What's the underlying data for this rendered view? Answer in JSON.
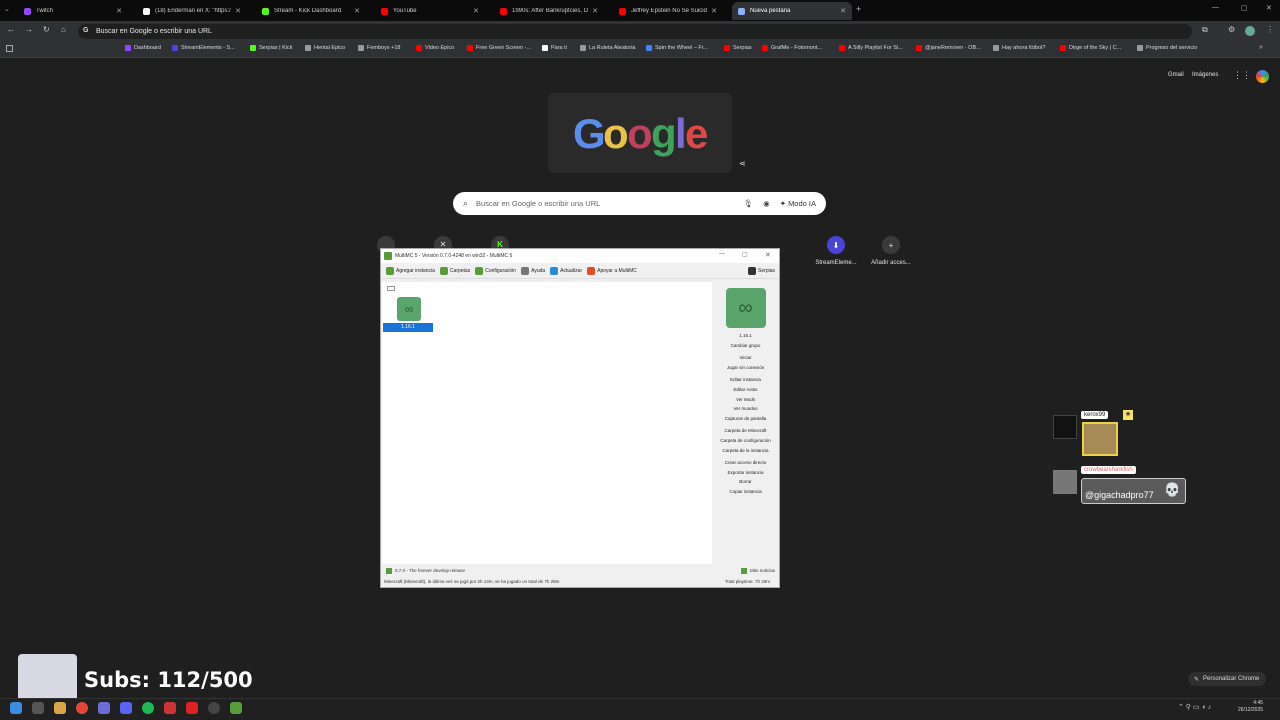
{
  "browser": {
    "tabs": [
      {
        "title": "Twitch",
        "color": "#9146ff"
      },
      {
        "title": "(18) Enderman en X: \"https://t...",
        "color": "#ffffff"
      },
      {
        "title": "Stream - Kick Dashboard",
        "color": "#53fc18"
      },
      {
        "title": "YouTube",
        "color": "#ff0000"
      },
      {
        "title": "1990s: After Bankruptcies, Don...",
        "color": "#ff0000"
      },
      {
        "title": "Jeffrey Epstein No Se Suicidó |...",
        "color": "#ff0000"
      },
      {
        "title": "Nueva pestaña",
        "color": "#8ab4f8"
      }
    ],
    "omnibox": "Buscar en Google o escribir una URL",
    "bookmarks": [
      "Dashboard",
      "StreamElements - S...",
      "Serpias | Kick",
      "Hentai Epico",
      "Femboys +18",
      "Video Epico",
      "Free Green Screen -...",
      "Para ti",
      "La Ruleta Aleatoria",
      "Spin the Wheel – Fr...",
      "Serpias",
      "GrafMe - Fotomont...",
      "A Silly Playlist For Si...",
      "@janeRemover - OB...",
      "Hay ahora fútbol?",
      "Dirge of the Sky | C...",
      "Progreso del servicio"
    ]
  },
  "google": {
    "header_links": [
      "Gmail",
      "Imágenes"
    ],
    "search_placeholder": "Buscar en Google o escribir una URL",
    "ai_mode": "Modo IA",
    "shortcuts": [
      "StreamEleme...",
      "Añadir acces..."
    ],
    "customize": "Personalizar Chrome"
  },
  "multimc": {
    "title": "MultiMC 5 - Versión 0.7.0-4248 en win32 - MultiMC 5",
    "toolbar": [
      "Agregar instancia",
      "Carpetas",
      "Configuración",
      "Ayuda",
      "Actualizar",
      "Apoyar a MultiMC",
      "Serpias"
    ],
    "instance_label": "1.16.1",
    "side_version": "1.16.1",
    "side_group": "Cambiar grupo",
    "side_actions": [
      "Iniciar",
      "Jugar sin conexión",
      "Editar instancia",
      "Editar notas",
      "Ver Mods",
      "Ver mundos",
      "Capturas de pantalla",
      "Carpeta de Minecraft",
      "Carpeta de configuración",
      "Carpeta de la instancia",
      "Crear acceso directo",
      "Exportar instancia",
      "Borrar",
      "Copiar instancia"
    ],
    "news": "0.7.0 - The forever develop release",
    "more_news": "Más noticias",
    "status": "Minecraft (Minecraft), la última vez se jugó por 2h 13m, se ha jugado un total de 7h 29m",
    "total_playtime": "Total playtime: 7h 29m"
  },
  "overlay": {
    "chat_names": [
      "kerox99",
      "crowbearsharkfish",
      "@gigachadpro77"
    ],
    "subs": "Subs: 112/500"
  },
  "taskbar": {
    "time": "4:45",
    "date": "26/12/2025"
  }
}
